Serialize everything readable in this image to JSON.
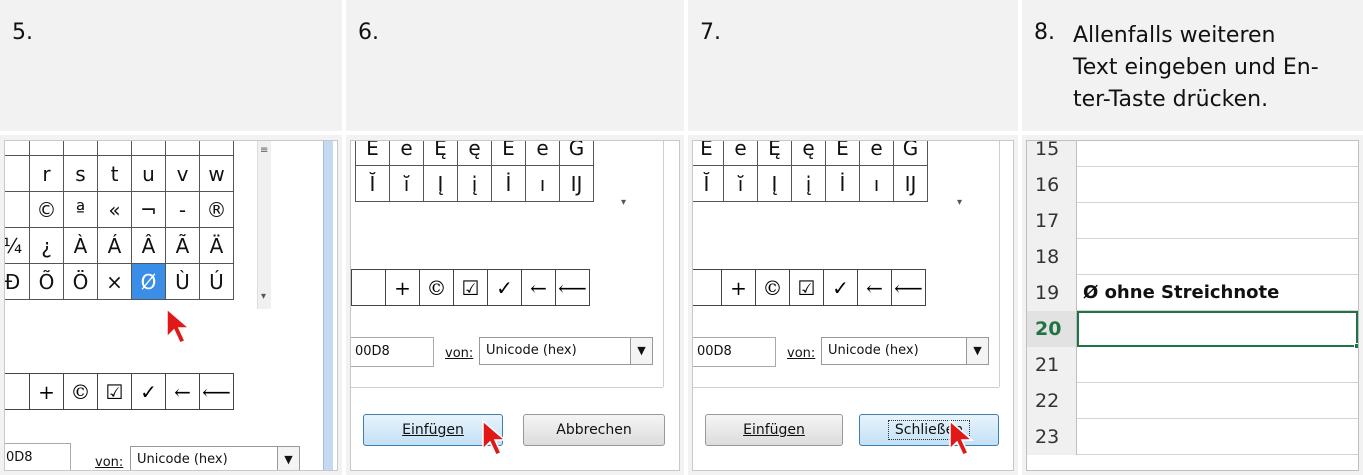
{
  "steps": [
    {
      "num": "5."
    },
    {
      "num": "6."
    },
    {
      "num": "7."
    },
    {
      "num": "8.",
      "text_lines": [
        "Allenfalls weiteren",
        "Text eingeben und En-",
        "ter-Taste drücken."
      ]
    }
  ],
  "panel5": {
    "grid_rows": [
      [
        "",
        "r",
        "s",
        "t",
        "u",
        "v",
        "w"
      ],
      [
        "",
        "©",
        "ª",
        "«",
        "¬",
        "-",
        "®"
      ],
      [
        "¼",
        "¿",
        "À",
        "Á",
        "Â",
        "Ã",
        "Ä"
      ],
      [
        "Ð",
        "Õ",
        "Ö",
        "×",
        "Ø",
        "Ù",
        "Ú"
      ]
    ],
    "recent": [
      "",
      "+",
      "©",
      "☑",
      "✓",
      "←",
      "⟵"
    ],
    "code": "0D8",
    "von_label": "von:",
    "encoding": "Unicode (hex)"
  },
  "panel6": {
    "grid_rows": [
      [
        "E",
        "e",
        "Ę",
        "ę",
        "E",
        "e",
        "G"
      ],
      [
        "Ĭ",
        "ĭ",
        "Į",
        "į",
        "İ",
        "ı",
        "Ĳ"
      ]
    ],
    "recent": [
      "",
      "+",
      "©",
      "☑",
      "✓",
      "←",
      "⟵"
    ],
    "code": "00D8",
    "von_label": "von:",
    "encoding": "Unicode (hex)",
    "insert_label": "Einfügen",
    "cancel_label": "Abbrechen"
  },
  "panel7": {
    "grid_rows": [
      [
        "E",
        "e",
        "Ę",
        "ę",
        "E",
        "e",
        "G"
      ],
      [
        "Ĭ",
        "ĭ",
        "Į",
        "į",
        "İ",
        "ı",
        "Ĳ"
      ]
    ],
    "recent": [
      "",
      "+",
      "©",
      "☑",
      "✓",
      "←",
      "⟵"
    ],
    "code": "00D8",
    "von_label": "von:",
    "encoding": "Unicode (hex)",
    "insert_label": "Einfügen",
    "close_label": "Schließen"
  },
  "excel": {
    "rows": [
      {
        "num": "15",
        "value": ""
      },
      {
        "num": "16",
        "value": ""
      },
      {
        "num": "17",
        "value": ""
      },
      {
        "num": "18",
        "value": ""
      },
      {
        "num": "19",
        "value": "Ø ohne Streichnote"
      },
      {
        "num": "20",
        "value": ""
      },
      {
        "num": "21",
        "value": ""
      },
      {
        "num": "22",
        "value": ""
      },
      {
        "num": "23",
        "value": ""
      }
    ],
    "active_row": "20"
  },
  "colors": {
    "accent": "#3b8ee8",
    "excel_green": "#217346",
    "cursor": "#e01818"
  }
}
